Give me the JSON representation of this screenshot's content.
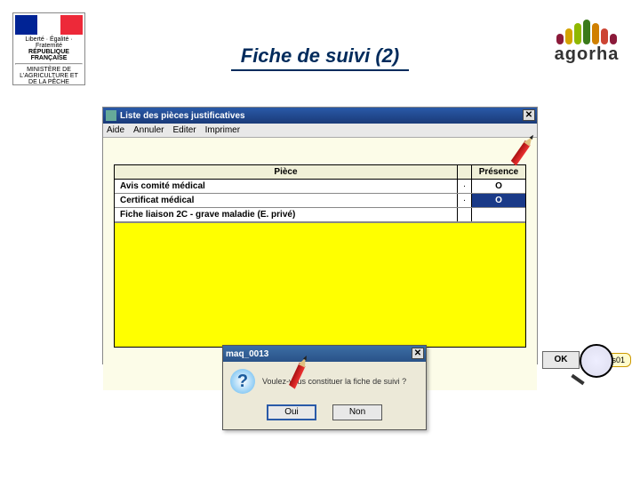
{
  "page": {
    "title": "Fiche de suivi (2)"
  },
  "logos": {
    "ministry_line1": "Liberté · Égalité · Fraternité",
    "ministry_line2": "RÉPUBLIQUE FRANÇAISE",
    "ministry_line3": "MINISTÈRE DE L'AGRICULTURE ET DE LA PÊCHE",
    "agorha": "agorha"
  },
  "window": {
    "title": "Liste des pièces justificatives",
    "menu": {
      "aide": "Aide",
      "annuler": "Annuler",
      "editer": "Editer",
      "imprimer": "Imprimer"
    },
    "table": {
      "header_piece": "Pièce",
      "header_presence": "Présence",
      "rows": [
        {
          "piece": "Avis comité médical",
          "dot": ".",
          "presence": "O"
        },
        {
          "piece": "Certificat médical",
          "dot": ".",
          "presence": "O"
        },
        {
          "piece": "Fiche liaison 2C - grave maladie (E. privé)",
          "dot": "",
          "presence": ""
        }
      ]
    },
    "ok_label": "OK",
    "sp_label": "sp_pcs01"
  },
  "dialog": {
    "title": "maq_0013",
    "message": "Voulez-vous constituer la fiche de suivi ?",
    "btn_yes": "Oui",
    "btn_no": "Non"
  }
}
